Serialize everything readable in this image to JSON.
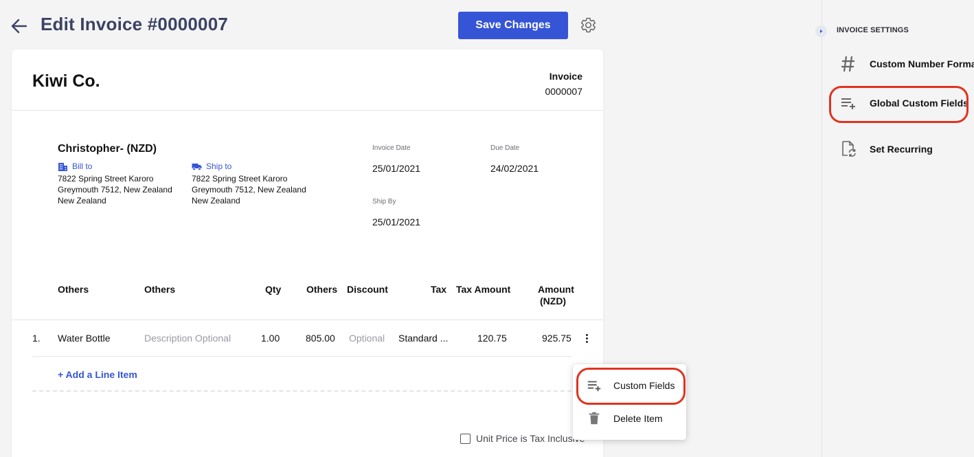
{
  "header": {
    "title": "Edit Invoice #0000007",
    "save_label": "Save Changes"
  },
  "invoice": {
    "company": "Kiwi Co.",
    "label": "Invoice",
    "number": "0000007",
    "customer": "Christopher- (NZD)",
    "bill_to": {
      "label": "Bill to",
      "lines": [
        "7822 Spring Street Karoro",
        "Greymouth 7512, New Zealand",
        "New Zealand"
      ]
    },
    "ship_to": {
      "label": "Ship to",
      "lines": [
        "7822 Spring Street Karoro",
        "Greymouth 7512, New Zealand",
        "New Zealand"
      ]
    },
    "invoice_date": {
      "label": "Invoice Date",
      "value": "25/01/2021"
    },
    "due_date": {
      "label": "Due Date",
      "value": "24/02/2021"
    },
    "ship_by": {
      "label": "Ship By",
      "value": "25/01/2021"
    }
  },
  "table": {
    "headers": [
      "Others",
      "Others",
      "Qty",
      "Others",
      "Discount",
      "Tax",
      "Tax Amount",
      "Amount",
      "(NZD)"
    ],
    "rows": [
      {
        "index": "1.",
        "item": "Water Bottle",
        "description": "Description Optional",
        "qty": "1.00",
        "price": "805.00",
        "discount": "Optional",
        "tax": "Standard ...",
        "tax_amount": "120.75",
        "amount": "925.75"
      }
    ],
    "add_line_label": "+ Add a Line Item",
    "tax_inclusive_label": "Unit Price is Tax Inclusive"
  },
  "context_menu": {
    "items": [
      {
        "label": "Custom Fields",
        "icon": "playlist-add-icon"
      },
      {
        "label": "Delete Item",
        "icon": "trash-icon"
      }
    ]
  },
  "settings_panel": {
    "title": "INVOICE SETTINGS",
    "items": [
      {
        "label": "Custom Number Format",
        "icon": "hash-icon"
      },
      {
        "label": "Global Custom Fields",
        "icon": "playlist-add-icon"
      },
      {
        "label": "Set Recurring",
        "icon": "recurring-doc-icon"
      }
    ]
  },
  "colors": {
    "accent": "#3554d6",
    "title": "#3b4262",
    "highlight_ring": "#e0331f"
  }
}
